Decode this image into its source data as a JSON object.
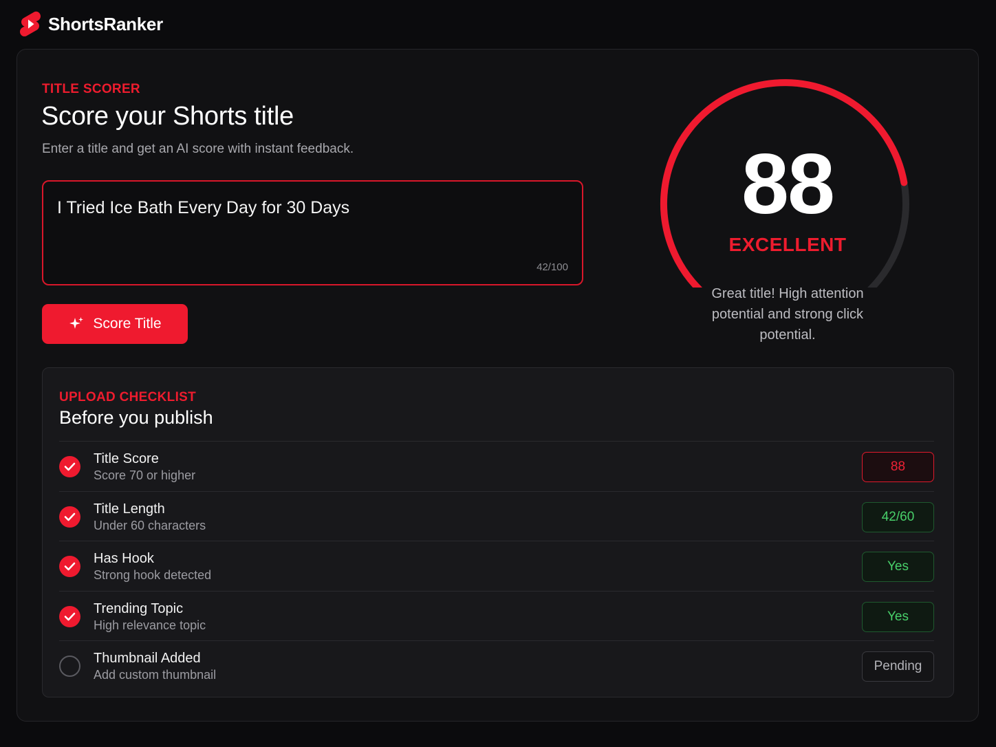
{
  "app": {
    "name": "ShortsRanker",
    "logo_icon": "shorts-play-icon",
    "accent": "#ef1a2f"
  },
  "scorer": {
    "eyebrow": "TITLE SCORER",
    "headline": "Score your Shorts title",
    "subhead": "Enter a title and get an AI score with instant feedback.",
    "input_value": "I Tried Ice Bath Every Day for 30 Days",
    "char_count": "42/100",
    "button_label": "Score Title",
    "button_icon": "sparkle-icon"
  },
  "gauge": {
    "score": "88",
    "score_value": 88,
    "max": 100,
    "label": "EXCELLENT",
    "feedback": "Great title! High attention potential and strong click potential.",
    "fill_color": "#ef1a2f",
    "track_color": "#2a2a2d"
  },
  "checklist": {
    "eyebrow": "UPLOAD CHECKLIST",
    "title": "Before you publish",
    "items": [
      {
        "label": "Title Score",
        "desc": "Score 70 or higher",
        "value": "88",
        "status": "done",
        "pill": "red"
      },
      {
        "label": "Title Length",
        "desc": "Under 60 characters",
        "value": "42/60",
        "status": "done",
        "pill": "green"
      },
      {
        "label": "Has Hook",
        "desc": "Strong hook detected",
        "value": "Yes",
        "status": "done",
        "pill": "green"
      },
      {
        "label": "Trending Topic",
        "desc": "High relevance topic",
        "value": "Yes",
        "status": "done",
        "pill": "green"
      },
      {
        "label": "Thumbnail Added",
        "desc": "Add custom thumbnail",
        "value": "Pending",
        "status": "pending",
        "pill": "grey"
      }
    ]
  }
}
